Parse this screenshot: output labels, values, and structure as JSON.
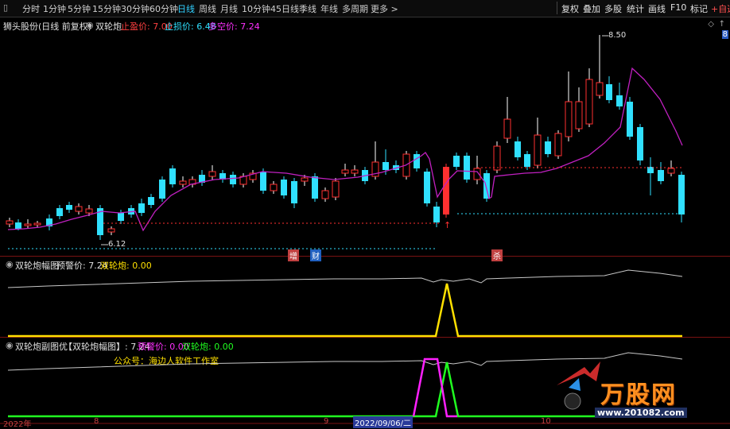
{
  "toolbar": {
    "pin_icon": "pin-icon",
    "periods": [
      "分时",
      "1分钟",
      "5分钟",
      "15分钟",
      "30分钟",
      "60分钟",
      "日线",
      "周线",
      "月线",
      "10分钟",
      "45日线",
      "季线",
      "年线",
      "多周期",
      "更多 >"
    ],
    "active_period": "日线",
    "right_items": [
      "复权",
      "叠加",
      "多股",
      "统计",
      "画线",
      "F10",
      "标记",
      "+自选",
      "◁"
    ]
  },
  "main": {
    "stock_name": "狮头股份(日线 前复权)",
    "indicator_name": "双轮炮",
    "stop_loss_label": "止盈价: 7.00",
    "stop_price_label": "止损价: 6.48",
    "long_short_label": "多空价: 7.24",
    "high_label": "8.50",
    "low_label": "6.12",
    "markers": [
      "增",
      "财",
      "杀"
    ],
    "right_badge": "8"
  },
  "sub1": {
    "title": "双轮炮幅图",
    "warn_label": "预警价: 7.24",
    "cannon_label": "双轮炮: 0.00"
  },
  "sub2": {
    "title": "双轮炮副图优",
    "bracket_label": "【双轮炮幅图】: 7.24",
    "warn_label": "预警价: 0.00",
    "cannon_label": "双轮炮: 0.00",
    "wechat_label": "公众号：海边人软件工作室"
  },
  "axis": {
    "year_label": "2022年",
    "m8": "8",
    "date_label": "2022/09/06/二",
    "m10": "10"
  },
  "watermark": {
    "brand": "万股网",
    "url": "www.201082.com"
  },
  "colors": {
    "up": "#ff3030",
    "down": "#30e0ff",
    "ma": "#c020c0",
    "warn": "#ffe000",
    "green": "#20ff20",
    "magenta": "#ff20ff"
  }
}
